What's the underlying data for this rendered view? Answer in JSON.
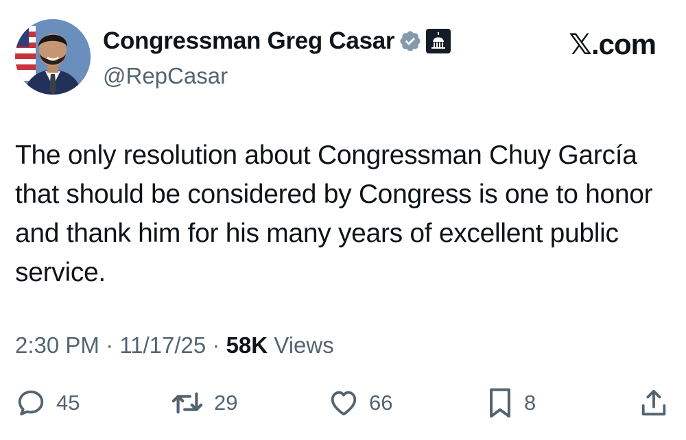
{
  "profile": {
    "display_name": "Congressman Greg Casar",
    "handle": "@RepCasar",
    "verified_icon": "verified-badge-gray",
    "affiliation_icon": "us-capitol-badge"
  },
  "brand": {
    "label": "𝕏.com"
  },
  "tweet": {
    "text": "The only resolution about Congressman Chuy García that should be considered by Congress is one to honor and thank him for his many years of excellent public service."
  },
  "meta": {
    "time": "2:30 PM",
    "separator1": " · ",
    "date": "11/17/25",
    "separator2": " · ",
    "views_count": "58K",
    "views_label": " Views"
  },
  "actions": {
    "replies": "45",
    "reposts": "29",
    "likes": "66",
    "bookmarks": "8"
  },
  "colors": {
    "text": "#0f1419",
    "secondary": "#536471",
    "verified_gray": "#829aab",
    "capitol_badge": "#141d26"
  }
}
